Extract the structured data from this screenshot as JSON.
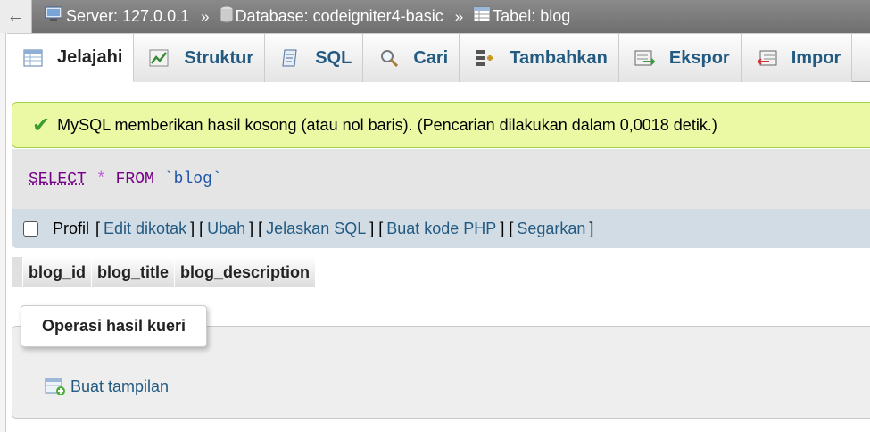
{
  "breadcrumb": {
    "back_label": "←",
    "separator": "»",
    "server": "Server: 127.0.0.1",
    "database": "Database: codeigniter4-basic",
    "table": "Tabel: blog"
  },
  "tabs": [
    {
      "label": "Jelajahi",
      "icon": "browse-icon",
      "active": true
    },
    {
      "label": "Struktur",
      "icon": "structure-icon",
      "active": false
    },
    {
      "label": "SQL",
      "icon": "sql-icon",
      "active": false
    },
    {
      "label": "Cari",
      "icon": "search-icon",
      "active": false
    },
    {
      "label": "Tambahkan",
      "icon": "insert-icon",
      "active": false
    },
    {
      "label": "Ekspor",
      "icon": "export-icon",
      "active": false
    },
    {
      "label": "Impor",
      "icon": "import-icon",
      "active": false
    }
  ],
  "message": {
    "check_icon": "✔",
    "text": "MySQL memberikan hasil kosong (atau nol baris). (Pencarian dilakukan dalam 0,0018 detik.)"
  },
  "query": {
    "select": "SELECT",
    "star": "*",
    "from": "FROM",
    "table": "`blog`"
  },
  "profil": {
    "label": "Profil",
    "links": [
      "Edit dikotak",
      "Ubah",
      "Jelaskan SQL",
      "Buat kode PHP",
      "Segarkan"
    ]
  },
  "columns": [
    "blog_id",
    "blog_title",
    "blog_description"
  ],
  "operations": {
    "legend": "Operasi hasil kueri",
    "create_view": "Buat tampilan"
  },
  "colors": {
    "link": "#235a81",
    "success_bg": "#ebf8a4",
    "profil_bg": "#d1dce5"
  }
}
